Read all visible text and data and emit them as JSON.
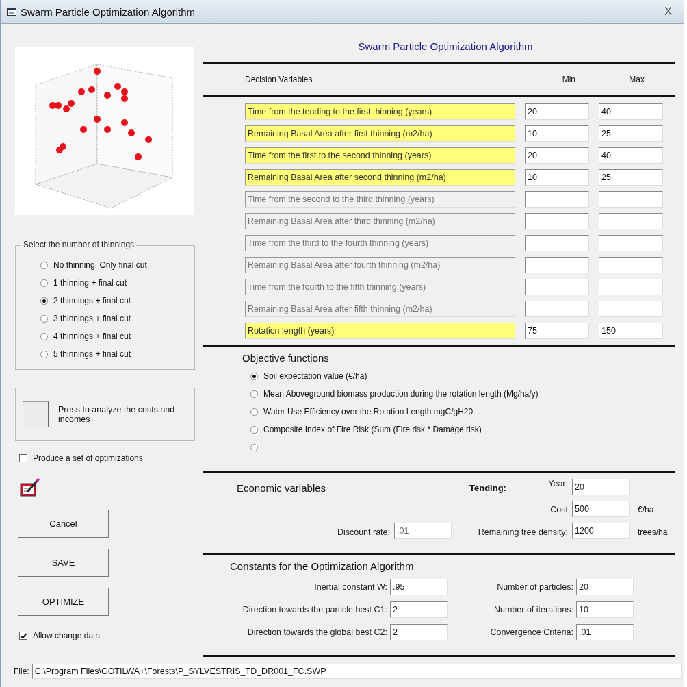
{
  "window": {
    "title": "Swarm Particle Optimization Algorithm",
    "close": "X"
  },
  "thinnings": {
    "title": "Select the number of thinnings",
    "options": [
      {
        "label": "No thinning, Only final cut",
        "selected": false
      },
      {
        "label": "1 thinning  + final cut",
        "selected": false
      },
      {
        "label": "2 thinnings + final cut",
        "selected": true
      },
      {
        "label": "3 thinnings + final cut",
        "selected": false
      },
      {
        "label": "4 thinnings + final cut",
        "selected": false
      },
      {
        "label": "5 thinnings + final cut",
        "selected": false
      }
    ]
  },
  "analyze": {
    "text": "Press to analyze the costs and incomes"
  },
  "produce_set": {
    "label": "Produce a set of optimizations",
    "checked": false
  },
  "buttons": [
    "Cancel",
    "SAVE",
    "OPTIMIZE"
  ],
  "allow_change": {
    "label": "Allow change data",
    "checked": true
  },
  "heading": "Swarm Particle  Optimization Algorithm",
  "decision": {
    "columns": [
      "Decision Variables",
      "Min",
      "Max"
    ],
    "rows": [
      {
        "label": "Time from the tending to the first thinning (years)",
        "enabled": true,
        "min": "20",
        "max": "40"
      },
      {
        "label": "Remaining Basal Area after first thinning (m2/ha)",
        "enabled": true,
        "min": "10",
        "max": "25"
      },
      {
        "label": "Time from the first to the second thinning (years)",
        "enabled": true,
        "min": "20",
        "max": "40"
      },
      {
        "label": "Remaining Basal Area after second thinning (m2/ha)",
        "enabled": true,
        "min": "10",
        "max": "25"
      },
      {
        "label": "Time from the second to the third thinning (years)",
        "enabled": false
      },
      {
        "label": "Remaining Basal Area after third thinning (m2/ha)",
        "enabled": false
      },
      {
        "label": "Time from the third to the fourth thinning (years)",
        "enabled": false
      },
      {
        "label": "Remaining Basal Area after fourth thinning (m2/ha)",
        "enabled": false
      },
      {
        "label": "Time from the fourth to the fifth thinning (years)",
        "enabled": false
      },
      {
        "label": "Remaining Basal Area after fifth thinning (m2/ha)",
        "enabled": false
      },
      {
        "label": "Rotation length (years)",
        "enabled": true,
        "min": "75",
        "max": "150"
      }
    ]
  },
  "objectives": {
    "title": "Objective functions",
    "options": [
      {
        "label": "Soil expectation value (€/ha)",
        "selected": true
      },
      {
        "label": "Mean Aboveground biomass production during the rotation length (Mg/ha/y)",
        "selected": false
      },
      {
        "label": "Water Use Efficiency over the Rotation Length mgC/gH20",
        "selected": false
      },
      {
        "label": "Composite Index of Fire Risk (Sum (Fire risk * Damage risk)",
        "selected": false
      },
      {
        "selected": false
      }
    ]
  },
  "economic": {
    "title": "Economic variables",
    "tending_label": "Tending:",
    "year_label": "Year:",
    "year": "20",
    "cost_label": "Cost",
    "cost": "500",
    "cost_unit": "€/ha",
    "discount_label": "Discount rate:",
    "discount": ".01",
    "density_label": "Remaining tree density:",
    "density": "1200",
    "density_unit": "trees/ha"
  },
  "constants": {
    "title": "Constants for the Optimization Algorithm",
    "fields": [
      {
        "label": "Inertial constant W:",
        "value": ".95"
      },
      {
        "label": "Number of particles:",
        "value": "20"
      },
      {
        "label": "Direction towards the particle best C1:",
        "value": "2"
      },
      {
        "label": "Number of iterations:",
        "value": "10"
      },
      {
        "label": "Direction towards the global best C2:",
        "value": "2"
      },
      {
        "label": "Convergence Criteria:",
        "value": ".01"
      }
    ]
  },
  "file": {
    "label": "File:",
    "value": "C:\\Program Files\\GOTILWA+\\Forests\\P_SYLVESTRIS_TD_DR001_FC.SWP"
  }
}
